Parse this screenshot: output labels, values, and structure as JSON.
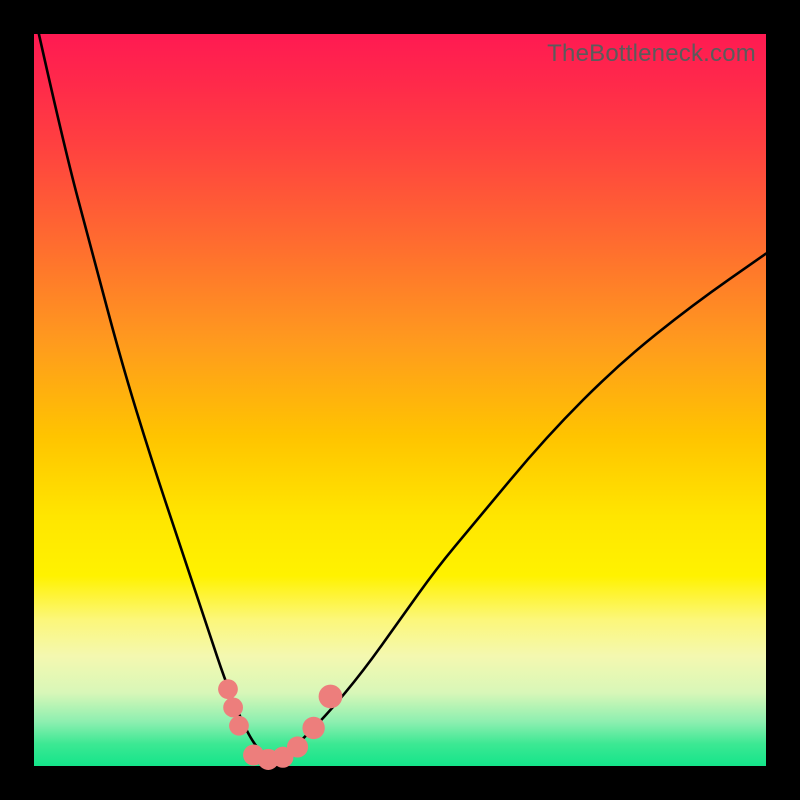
{
  "watermark": "TheBottleneck.com",
  "colors": {
    "frame_bg": "#000000",
    "gradient_top": "#ff1a52",
    "gradient_bottom": "#14e58a",
    "curve": "#000000",
    "marker_fill": "#ed7e7c",
    "marker_stroke": "#d46a68"
  },
  "chart_data": {
    "type": "line",
    "title": "",
    "xlabel": "",
    "ylabel": "",
    "xlim": [
      0,
      100
    ],
    "ylim": [
      0,
      100
    ],
    "grid": false,
    "legend": false,
    "series": [
      {
        "name": "bottleneck-curve",
        "x": [
          0,
          4,
          8,
          12,
          16,
          20,
          24,
          26,
          28,
          30,
          32,
          34,
          36,
          40,
          45,
          50,
          55,
          60,
          70,
          80,
          90,
          100
        ],
        "y": [
          103,
          85,
          70,
          55,
          42,
          30,
          18,
          12,
          7,
          3,
          1,
          1,
          3,
          7,
          13,
          20,
          27,
          33,
          45,
          55,
          63,
          70
        ]
      }
    ],
    "markers": [
      {
        "name": "marker-left-1",
        "x": 26.5,
        "y": 10.5,
        "r": 1.5
      },
      {
        "name": "marker-left-2",
        "x": 27.2,
        "y": 8.0,
        "r": 1.5
      },
      {
        "name": "marker-left-3",
        "x": 28.0,
        "y": 5.5,
        "r": 1.5
      },
      {
        "name": "marker-bottom-1",
        "x": 30.0,
        "y": 1.5,
        "r": 1.6
      },
      {
        "name": "marker-bottom-2",
        "x": 32.0,
        "y": 0.9,
        "r": 1.6
      },
      {
        "name": "marker-bottom-3",
        "x": 34.0,
        "y": 1.2,
        "r": 1.6
      },
      {
        "name": "marker-bottom-4",
        "x": 36.0,
        "y": 2.6,
        "r": 1.6
      },
      {
        "name": "marker-right-1",
        "x": 38.2,
        "y": 5.2,
        "r": 1.7
      },
      {
        "name": "marker-right-2",
        "x": 40.5,
        "y": 9.5,
        "r": 1.8
      }
    ]
  }
}
